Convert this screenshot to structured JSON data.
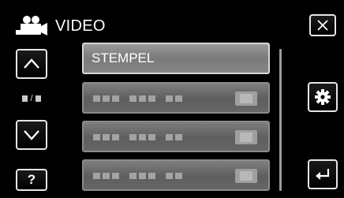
{
  "header": {
    "title": "VIDEO",
    "mode_icon": "video-camera-icon"
  },
  "controls": {
    "close_icon": "close-icon",
    "up_icon": "chevron-up-icon",
    "down_icon": "chevron-down-icon",
    "help_label": "?",
    "settings_icon": "gear-icon",
    "back_icon": "return-arrow-icon",
    "page_indicator_separator": "/"
  },
  "list": {
    "items": [
      {
        "label": "STEMPEL",
        "selected": true
      }
    ]
  },
  "colors": {
    "background": "#000000",
    "item_fill": "#6e6e6e",
    "selected_item_fill": "#858585",
    "button_border": "#e6e6e6"
  }
}
